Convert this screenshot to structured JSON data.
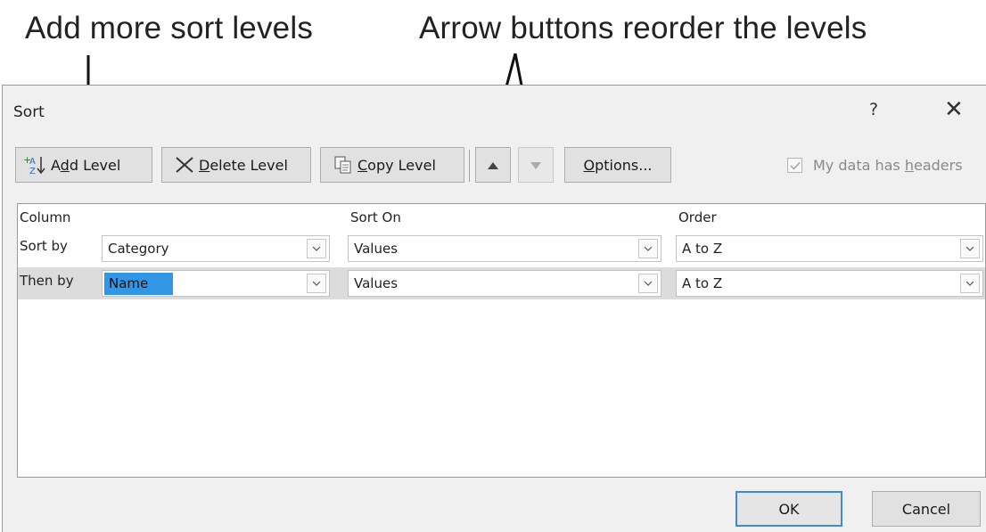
{
  "callouts": {
    "left": "Add more sort levels",
    "right": "Arrow buttons reorder the levels"
  },
  "dialog": {
    "title": "Sort",
    "help_label": "?",
    "close_label": "✕"
  },
  "toolbar": {
    "add_level": {
      "pre": "A",
      "key": "d",
      "post": "d Level"
    },
    "delete_level": {
      "key": "D",
      "post": "elete Level"
    },
    "copy_level": {
      "key": "C",
      "post": "opy Level"
    },
    "options": {
      "key": "O",
      "post": "ptions..."
    },
    "move_up_icon": "triangle-up",
    "move_down_icon": "triangle-down",
    "headers_checkbox": {
      "checked": true,
      "pre": "My data has ",
      "key": "h",
      "post": "eaders"
    }
  },
  "grid": {
    "headers": {
      "column": "Column",
      "sort_on": "Sort On",
      "order": "Order"
    },
    "rows": [
      {
        "label": "Sort by",
        "column": "Category",
        "sort_on": "Values",
        "order": "A to Z"
      },
      {
        "label": "Then by",
        "column": "Name",
        "sort_on": "Values",
        "order": "A to Z"
      }
    ]
  },
  "footer": {
    "ok": "OK",
    "cancel": "Cancel"
  },
  "colors": {
    "selection": "#3296e6",
    "default_button_border": "#3c8ad8",
    "dialog_bg": "#f0f0f0"
  }
}
